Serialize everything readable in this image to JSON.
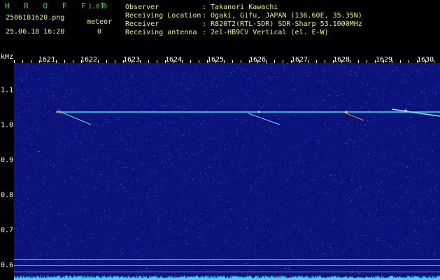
{
  "header": {
    "app_title": "H R O F F T",
    "app_version": "1.0.0",
    "file_name": "2506181620.png",
    "meteor_label": "meteor",
    "datetime": "25.06.18 16:20",
    "meteor_count": "0",
    "info": [
      {
        "label": "Observer",
        "value": ": Takanori Kawachi"
      },
      {
        "label": "Receiving Location",
        "value": ": Ogaki, Gifu, JAPAN (136.60E, 35.35N)"
      },
      {
        "label": "Receiver",
        "value": ": R820T2(RTL-SDR) SDR-Sharp 53.1000MHz"
      },
      {
        "label": "Receiving antenna",
        "value": ": 2el-HB9CV Vertical (el. E-W)"
      }
    ]
  },
  "spectrogram": {
    "y_unit": "kHz",
    "x_ticks": [
      "1621",
      "1622",
      "1623",
      "1624",
      "1625",
      "1626",
      "1627",
      "1628",
      "1629",
      "1630"
    ],
    "y_ticks": [
      "1.1",
      "1.0",
      "0.9",
      "0.8",
      "0.7",
      "0.6"
    ],
    "background_color": "#0b1279",
    "carrier_color": "#3fe0ff"
  }
}
